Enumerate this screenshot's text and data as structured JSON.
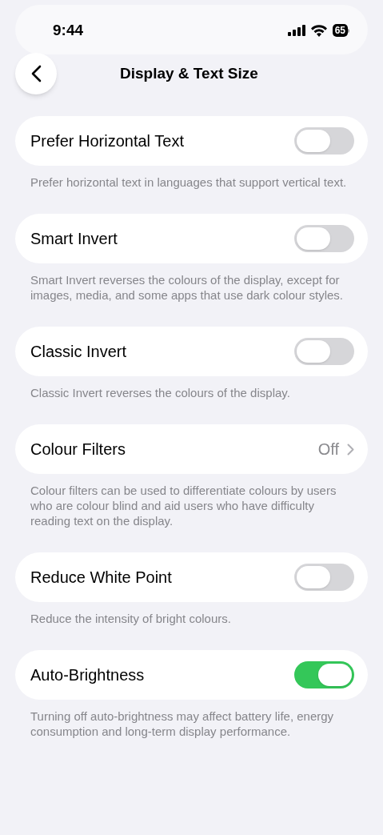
{
  "status_bar": {
    "time": "9:44",
    "battery": "65"
  },
  "nav": {
    "title": "Display & Text Size"
  },
  "settings": [
    {
      "kind": "toggle",
      "label": "Prefer Horizontal Text",
      "on": false,
      "footer": "Prefer horizontal text in languages that support vertical text."
    },
    {
      "kind": "toggle",
      "label": "Smart Invert",
      "on": false,
      "footer": "Smart Invert reverses the colours of the display, except for images, media, and some apps that use dark colour styles."
    },
    {
      "kind": "toggle",
      "label": "Classic Invert",
      "on": false,
      "footer": "Classic Invert reverses the colours of the display."
    },
    {
      "kind": "link",
      "label": "Colour Filters",
      "value": "Off",
      "footer": "Colour filters can be used to differentiate colours by users who are colour blind and aid users who have difficulty reading text on the display."
    },
    {
      "kind": "toggle",
      "label": "Reduce White Point",
      "on": false,
      "footer": "Reduce the intensity of bright colours."
    },
    {
      "kind": "toggle",
      "label": "Auto-Brightness",
      "on": true,
      "footer": "Turning off auto-brightness may affect battery life, energy consumption and long-term display performance."
    }
  ]
}
